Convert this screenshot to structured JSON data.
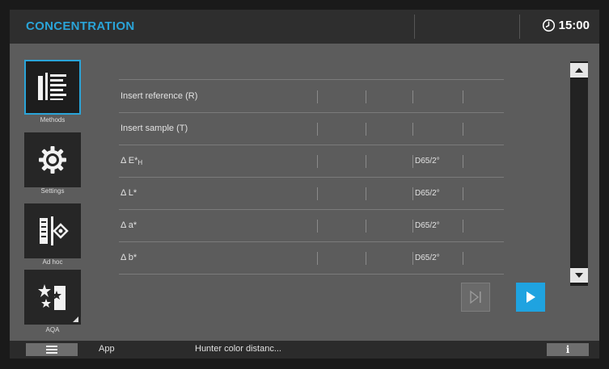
{
  "header": {
    "title": "CONCENTRATION",
    "time": "15:00",
    "clock_icon": "clock-icon"
  },
  "sidebar": {
    "items": [
      {
        "label": "Methods",
        "icon": "methods-list-icon",
        "active": true
      },
      {
        "label": "Settings",
        "icon": "gear-icon",
        "active": false
      },
      {
        "label": "Ad hoc",
        "icon": "adhoc-measure-icon",
        "active": false
      },
      {
        "label": "AQA",
        "icon": "aqa-stars-icon",
        "active": false
      }
    ]
  },
  "table": {
    "rows": [
      {
        "label": "Insert reference (R)",
        "illuminant": ""
      },
      {
        "label": "Insert sample (T)",
        "illuminant": ""
      },
      {
        "label": "Δ E*",
        "label_sub": "H",
        "illuminant": "D65/2°"
      },
      {
        "label": "Δ L*",
        "illuminant": "D65/2°"
      },
      {
        "label": "Δ a*",
        "illuminant": "D65/2°"
      },
      {
        "label": "Δ b*",
        "illuminant": "D65/2°"
      }
    ]
  },
  "controls": {
    "skip_icon": "skip-end-icon",
    "play_icon": "play-icon"
  },
  "footer": {
    "app_label": "App",
    "method_name": "Hunter color distanc...",
    "info_label": "i",
    "menu_icon": "hamburger-menu-icon"
  },
  "colors": {
    "accent": "#2aa4d8",
    "play": "#1fa3e0"
  }
}
